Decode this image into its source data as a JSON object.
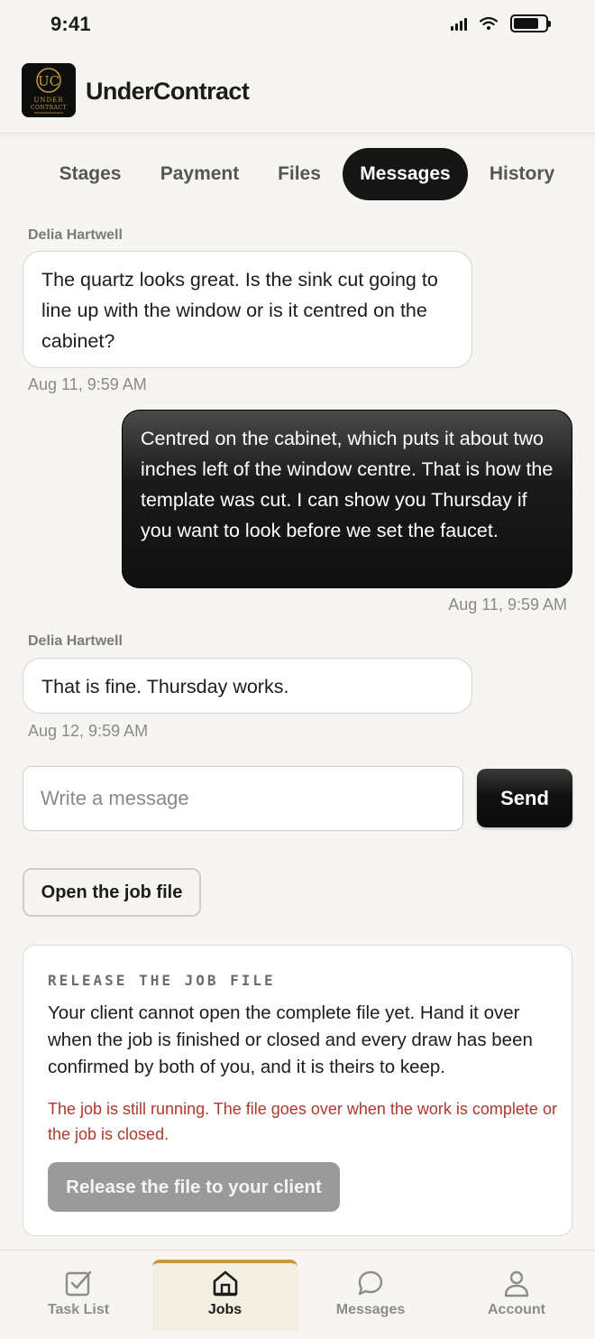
{
  "status_bar": {
    "time": "9:41"
  },
  "app": {
    "title": "UnderContract",
    "logo_icon": "undercontract-logo-icon"
  },
  "tabs": [
    {
      "label": "Stages",
      "active": false
    },
    {
      "label": "Payment",
      "active": false
    },
    {
      "label": "Files",
      "active": false
    },
    {
      "label": "Messages",
      "active": true
    },
    {
      "label": "History",
      "active": false
    }
  ],
  "messages": [
    {
      "direction": "incoming",
      "sender": "Delia Hartwell",
      "text": "The quartz looks great. Is the sink cut going to line up with the window or is it centred on the cabinet?",
      "timestamp": "Aug 11, 9:59 AM"
    },
    {
      "direction": "outgoing",
      "sender": "",
      "text": "Centred on the cabinet, which puts it about two inches left of the window centre. That is how the template was cut. I can show you Thursday if you want to look before we set the faucet.",
      "timestamp": "Aug 11, 9:59 AM"
    },
    {
      "direction": "incoming",
      "sender": "Delia Hartwell",
      "text": "That is fine. Thursday works.",
      "timestamp": "Aug 12, 9:59 AM"
    }
  ],
  "composer": {
    "placeholder": "Write a message",
    "value": "",
    "send_label": "Send"
  },
  "open_job_file_label": "Open the job file",
  "release": {
    "heading": "RELEASE THE JOB FILE",
    "body": "Your client cannot open the complete file yet. Hand it over when the job is finished or closed and every draw has been confirmed by both of you, and it is theirs to keep.",
    "warning": "The job is still running. The file goes over when the work is complete or the job is closed.",
    "button_label": "Release the file to your client",
    "button_enabled": false
  },
  "bottom_nav": [
    {
      "label": "Task List",
      "icon": "checkbox-icon",
      "active": false
    },
    {
      "label": "Jobs",
      "icon": "home-icon",
      "active": true
    },
    {
      "label": "Messages",
      "icon": "chat-bubble-icon",
      "active": false
    },
    {
      "label": "Account",
      "icon": "person-icon",
      "active": false
    }
  ],
  "colors": {
    "accent_gold": "#c79a3e",
    "primary_dark": "#161616",
    "warning_red": "#b0372b",
    "background": "#f6f5f2"
  }
}
